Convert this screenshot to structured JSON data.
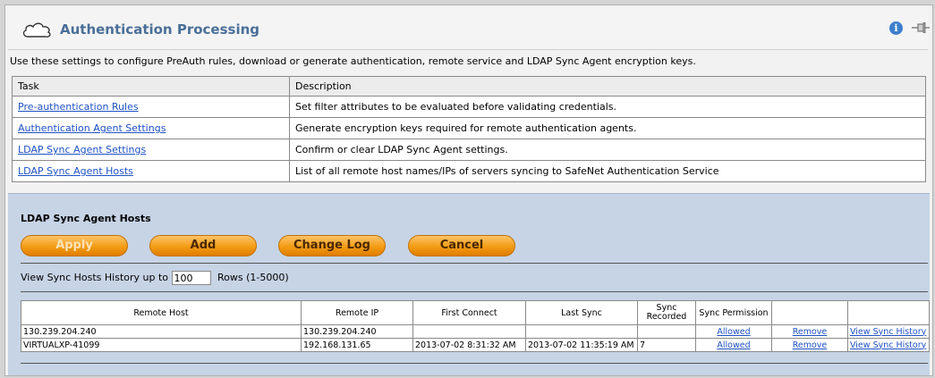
{
  "header": {
    "title": "Authentication Processing"
  },
  "intro": "Use these settings to configure PreAuth rules, download or generate authentication, remote service and LDAP Sync Agent encryption keys.",
  "tasks": {
    "columns": [
      "Task",
      "Description"
    ],
    "rows": [
      {
        "task": "Pre-authentication Rules",
        "description": "Set filter attributes to be evaluated before validating credentials."
      },
      {
        "task": "Authentication Agent Settings",
        "description": "Generate encryption keys required for remote authentication agents."
      },
      {
        "task": "LDAP Sync Agent Settings",
        "description": "Confirm or clear LDAP Sync Agent settings."
      },
      {
        "task": "LDAP Sync Agent Hosts",
        "description": "List of all remote host names/IPs of servers syncing to SafeNet Authentication Service"
      }
    ]
  },
  "panel": {
    "title": "LDAP Sync Agent Hosts",
    "buttons": {
      "apply": "Apply",
      "add": "Add",
      "change_log": "Change Log",
      "cancel": "Cancel"
    },
    "history": {
      "prefix": "View Sync Hosts History up to",
      "value": "100",
      "suffix": "Rows (1-5000)"
    }
  },
  "hosts": {
    "columns": [
      "Remote Host",
      "Remote IP",
      "First Connect",
      "Last Sync",
      "Sync Recorded",
      "Sync Permission",
      "",
      ""
    ],
    "rows": [
      {
        "host": "130.239.204.240",
        "ip": "130.239.204.240",
        "first": "",
        "last": "",
        "recorded": "",
        "permission": "Allowed",
        "remove": "Remove",
        "history": "View Sync History"
      },
      {
        "host": "VIRTUALXP-41099",
        "ip": "192.168.131.65",
        "first": "2013-07-02 8:31:32 AM",
        "last": "2013-07-02 11:35:19 AM",
        "recorded": "7",
        "permission": "Allowed",
        "remove": "Remove",
        "history": "View Sync History"
      }
    ]
  }
}
